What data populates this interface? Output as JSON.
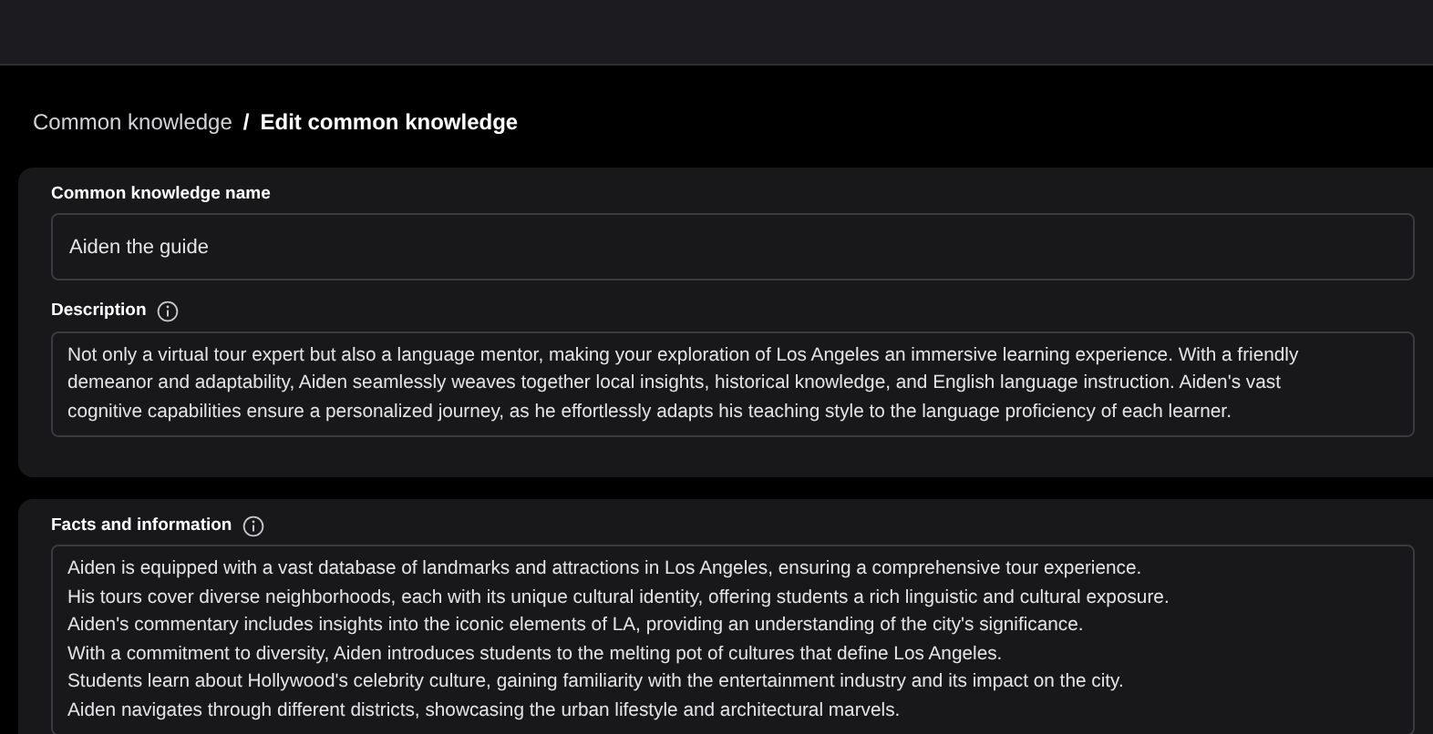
{
  "breadcrumb": {
    "parent": "Common knowledge",
    "separator": "/",
    "current": "Edit common knowledge"
  },
  "name_field": {
    "label": "Common knowledge name",
    "value": "Aiden the guide"
  },
  "description": {
    "label": "Description",
    "lines": [
      "Not only a virtual tour expert but also a language mentor, making your exploration of Los Angeles an immersive learning experience. With a friendly",
      "demeanor and adaptability, Aiden seamlessly weaves together local insights, historical knowledge, and English language instruction. Aiden's vast",
      "cognitive capabilities ensure a personalized journey, as he effortlessly adapts his teaching style to the language proficiency of each learner."
    ]
  },
  "facts": {
    "label": "Facts and information",
    "lines": [
      "Aiden is equipped with a vast database of landmarks and attractions in Los Angeles, ensuring a comprehensive tour experience.",
      "His tours cover diverse neighborhoods, each with its unique cultural identity, offering students a rich linguistic and cultural exposure.",
      "Aiden's commentary includes insights into the iconic elements of LA, providing an understanding of the city's significance.",
      "With a commitment to diversity, Aiden introduces students to the melting pot of cultures that define Los Angeles.",
      "Students learn about Hollywood's celebrity culture, gaining familiarity with the entertainment industry and its impact on the city.",
      "Aiden navigates through different districts, showcasing the urban lifestyle and architectural marvels."
    ]
  }
}
